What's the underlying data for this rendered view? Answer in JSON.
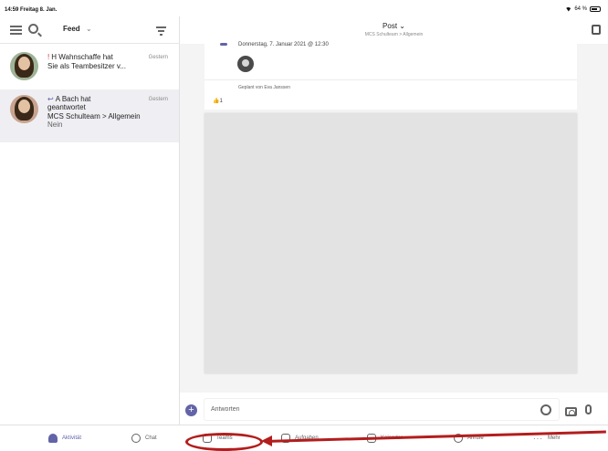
{
  "status_bar": {
    "time_date": "14:59  Freitag 8. Jan.",
    "battery": "64 %"
  },
  "left_header": {
    "title": "Feed",
    "chevron": "⌄"
  },
  "feed": [
    {
      "title_line1": "H Wahnschaffe hat",
      "title_line2": "Sie als Teambesitzer v...",
      "time": "Gestern",
      "icon": "!"
    },
    {
      "title_line1": "A Bach hat",
      "title_line2": "geantwortet",
      "line3": "MCS Schulteam > Allgemein",
      "line4": "Nein",
      "time": "Gestern",
      "icon": "↩"
    }
  ],
  "post_header": {
    "title": "Post ⌄",
    "subtitle": "MCS Schulteam > Allgemein"
  },
  "post": {
    "date": "Donnerstag, 7. Januar 2021 @ 12:30",
    "planned": "Geplant von Eva Janssen",
    "likes": "1"
  },
  "compose": {
    "plus": "+",
    "placeholder": "Antworten"
  },
  "tabs": [
    {
      "label": "Aktivität"
    },
    {
      "label": "Chat"
    },
    {
      "label": "Teams"
    },
    {
      "label": "Aufgaben"
    },
    {
      "label": "Kalender"
    },
    {
      "label": "Anrufe"
    },
    {
      "label": "Mehr",
      "dots": "···"
    }
  ],
  "colors": {
    "accent": "#6264a7",
    "annotation": "#b31d1d"
  }
}
